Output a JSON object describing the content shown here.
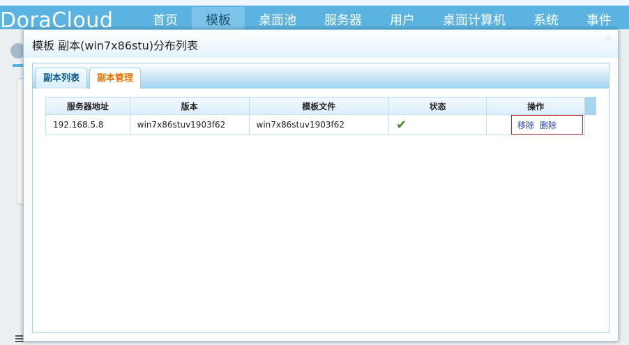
{
  "app": {
    "logo": "DoraCloud",
    "nav": [
      {
        "label": "首页"
      },
      {
        "label": "模板"
      },
      {
        "label": "桌面池"
      },
      {
        "label": "服务器"
      },
      {
        "label": "用户"
      },
      {
        "label": "桌面计算机"
      },
      {
        "label": "系统"
      },
      {
        "label": "事件"
      }
    ],
    "active_nav": "模板"
  },
  "dialog": {
    "title": "模板 副本(win7x86stu)分布列表",
    "close_glyph": "×",
    "tabs": [
      {
        "label": "副本列表",
        "active": false
      },
      {
        "label": "副本管理",
        "active": true
      }
    ],
    "table": {
      "headers": [
        "服务器地址",
        "版本",
        "模板文件",
        "状态",
        "操作"
      ],
      "rows": [
        {
          "server": "192.168.5.8",
          "version": "win7x86stuv1903f62",
          "template_file": "win7x86stuv1903f62",
          "status_icon": "check-icon",
          "actions": [
            "移除",
            "删除"
          ]
        }
      ]
    }
  },
  "colors": {
    "accent": "#5bb3e1",
    "active_tab_text": "#e07000",
    "link": "#1e3cc2",
    "ok": "#4a8a1e",
    "highlight_border": "#cc2a2a"
  }
}
